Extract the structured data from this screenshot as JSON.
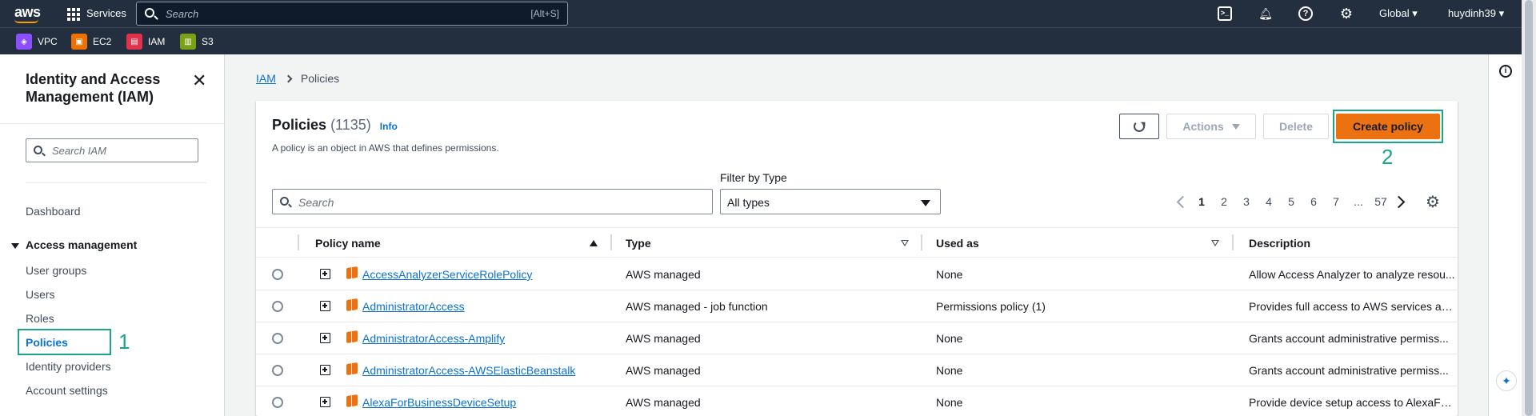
{
  "topnav": {
    "logo": "aws",
    "services_label": "Services",
    "search_placeholder": "Search",
    "search_shortcut": "[Alt+S]",
    "region": "Global ▾",
    "user": "huydinh39 ▾"
  },
  "favorites": [
    {
      "label": "VPC",
      "color": "#8c4fff"
    },
    {
      "label": "EC2",
      "color": "#ed7100"
    },
    {
      "label": "IAM",
      "color": "#dd344c"
    },
    {
      "label": "S3",
      "color": "#7aa116"
    }
  ],
  "sidenav": {
    "title": "Identity and Access Management (IAM)",
    "close": "✕",
    "search_placeholder": "Search IAM",
    "dashboard": "Dashboard",
    "section": "Access management",
    "items": [
      "User groups",
      "Users",
      "Roles",
      "Policies",
      "Identity providers",
      "Account settings"
    ],
    "active_item": "Policies",
    "annotation_1": "1"
  },
  "breadcrumb": {
    "root": "IAM",
    "current": "Policies"
  },
  "policies": {
    "title": "Policies",
    "count": "(1135)",
    "info": "Info",
    "description": "A policy is an object in AWS that defines permissions.",
    "buttons": {
      "actions": "Actions",
      "delete": "Delete",
      "create": "Create policy"
    },
    "annotation_2": "2",
    "filter_label": "Filter by Type",
    "search_placeholder": "Search",
    "filter_value": "All types",
    "pagination": {
      "pages": [
        "1",
        "2",
        "3",
        "4",
        "5",
        "6",
        "7",
        "...",
        "57"
      ],
      "current": "1"
    },
    "columns": [
      "Policy name",
      "Type",
      "Used as",
      "Description"
    ],
    "rows": [
      {
        "name": "AccessAnalyzerServiceRolePolicy",
        "type": "AWS managed",
        "used_as": "None",
        "description": "Allow Access Analyzer to analyze resou..."
      },
      {
        "name": "AdministratorAccess",
        "type": "AWS managed - job function",
        "used_as": "Permissions policy (1)",
        "description": "Provides full access to AWS services an..."
      },
      {
        "name": "AdministratorAccess-Amplify",
        "type": "AWS managed",
        "used_as": "None",
        "description": "Grants account administrative permiss..."
      },
      {
        "name": "AdministratorAccess-AWSElasticBeanstalk",
        "type": "AWS managed",
        "used_as": "None",
        "description": "Grants account administrative permiss..."
      },
      {
        "name": "AlexaForBusinessDeviceSetup",
        "type": "AWS managed",
        "used_as": "None",
        "description": "Provide device setup access to AlexaFo..."
      }
    ]
  },
  "colors": {
    "primary_button": "#ec7211",
    "link": "#0972d3",
    "annotation": "#1aa58c",
    "nav_bg": "#232f3e"
  }
}
